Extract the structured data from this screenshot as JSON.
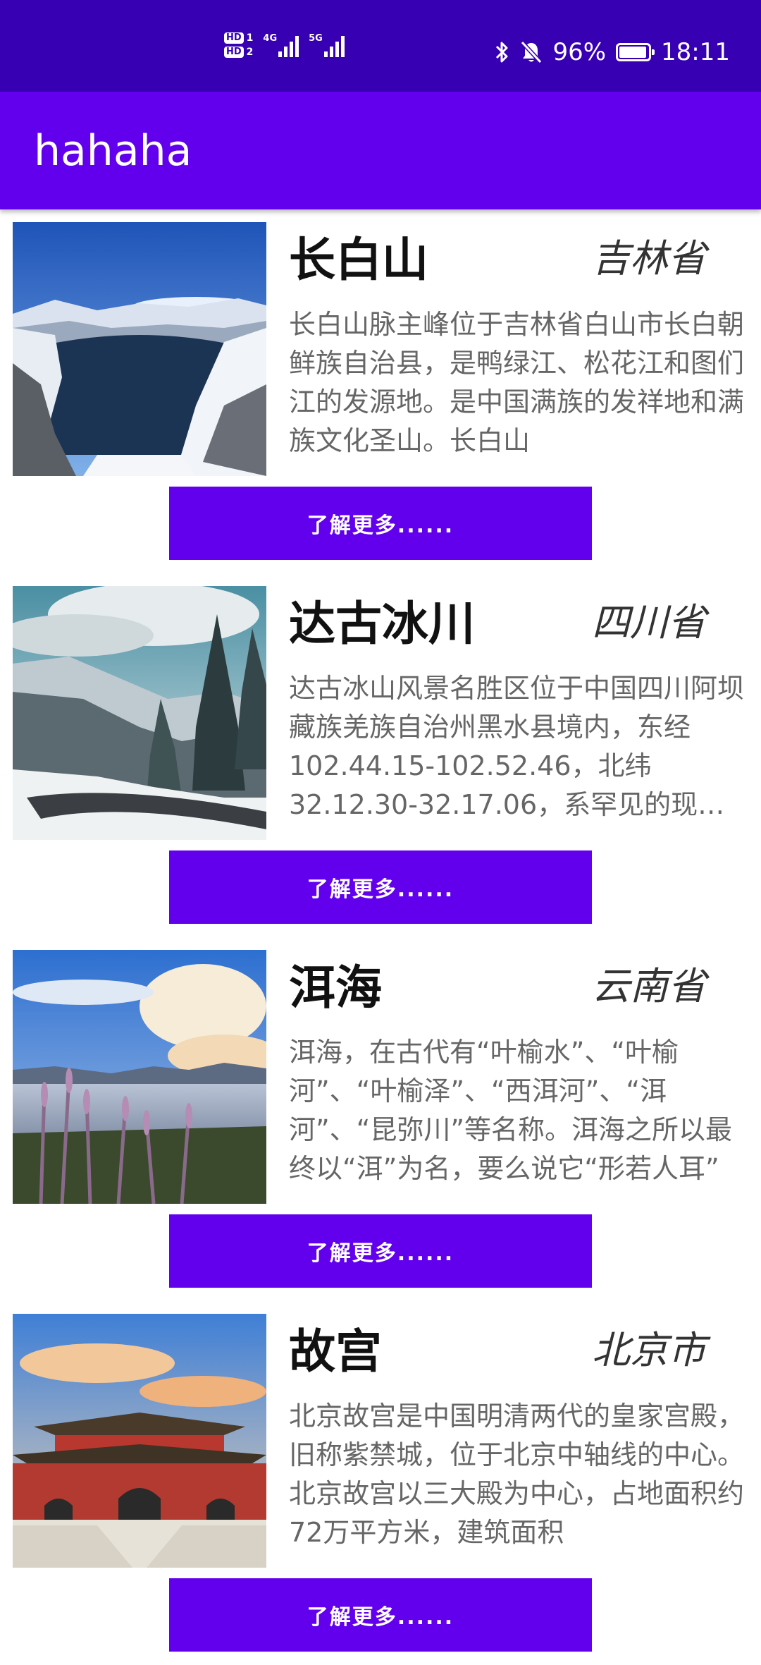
{
  "status_bar": {
    "sim1": "1",
    "sim2": "2",
    "hd_label": "HD",
    "net1": "4G",
    "net2": "5G",
    "battery_percent": "96%",
    "battery_level": 0.96,
    "time": "18:11",
    "icons": [
      "bluetooth-icon",
      "mute-icon",
      "battery-icon"
    ]
  },
  "app_bar": {
    "title": "hahaha",
    "color": "#6200EE"
  },
  "places": [
    {
      "name": "长白山",
      "province": "吉林省",
      "description": "长白山脉主峰位于吉林省白山市长白朝鲜族自治县，是鸭绿江、松花江和图们江的发源地。是中国满族的发祥地和满族文化圣山。长白山",
      "button": "了解更多......"
    },
    {
      "name": "达古冰川",
      "province": "四川省",
      "description": "达古冰山风景名胜区位于中国四川阿坝藏族羌族自治州黑水县境内，东经102.44.15-102.52.46，北纬32.12.30-32.17.06，系罕见的现代冰川",
      "button": "了解更多......"
    },
    {
      "name": "洱海",
      "province": "云南省",
      "description": "洱海，在古代有“叶榆水”、“叶榆河”、“叶榆泽”、“西洱河”、“洱河”、“昆弥川”等名称。洱海之所以最终以“洱”为名，要么说它“形若人耳”",
      "button": "了解更多......"
    },
    {
      "name": "故宫",
      "province": "北京市",
      "description": "北京故宫是中国明清两代的皇家宫殿，旧称紫禁城，位于北京中轴线的中心。北京故宫以三大殿为中心，占地面积约72万平方米，建筑面积",
      "button": "了解更多......"
    }
  ]
}
